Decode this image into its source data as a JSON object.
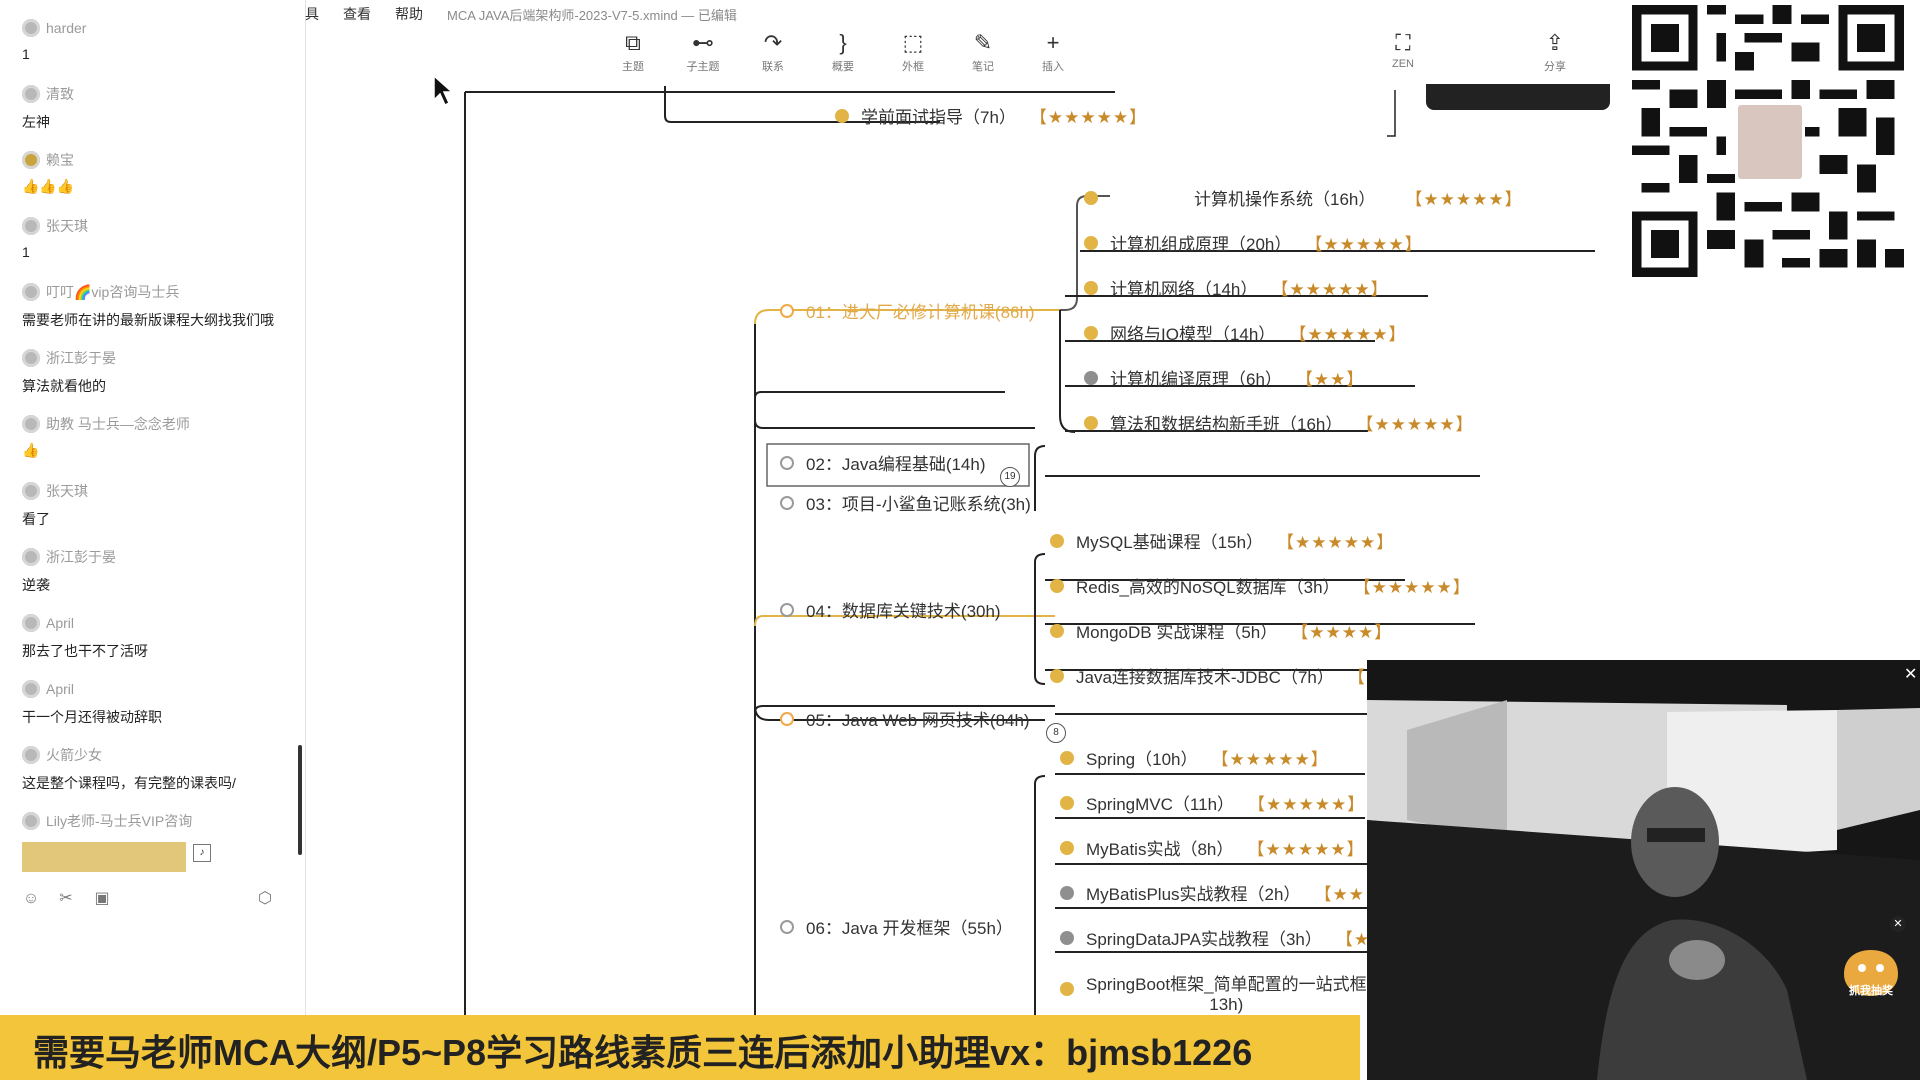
{
  "chat": {
    "messages": [
      {
        "user": "harder",
        "text": "1"
      },
      {
        "user": "清致",
        "text": "左神"
      },
      {
        "user": "赖宝",
        "text": "👍👍👍"
      },
      {
        "user": "张天琪",
        "text": "1"
      },
      {
        "user": "叮叮🌈vip咨询马士兵",
        "text": "需要老师在讲的最新版课程大纲找我们哦"
      },
      {
        "user": "浙江彭于晏",
        "text": "算法就看他的"
      },
      {
        "user": "助教 马士兵—念念老师",
        "text": "👍"
      },
      {
        "user": "张天琪",
        "text": "看了"
      },
      {
        "user": "浙江彭于晏",
        "text": "逆袭"
      },
      {
        "user": "April",
        "text": "那去了也干不了活呀"
      },
      {
        "user": "April",
        "text": "干一个月还得被动辞职"
      },
      {
        "user": "火箭少女",
        "text": "这是整个课程吗，有完整的课表吗/"
      },
      {
        "user": "Lily老师-马士兵VIP咨询",
        "text": ""
      }
    ],
    "tools": [
      "emoji-icon",
      "scissors-icon",
      "image-icon",
      "gift-icon"
    ]
  },
  "app": {
    "menu": [
      "具",
      "查看",
      "帮助"
    ],
    "document_title": "MCA JAVA后端架构师-2023-V7-5.xmind — 已编辑",
    "toolbar": [
      {
        "icon": "topic-icon",
        "label": "主题"
      },
      {
        "icon": "subtopic-icon",
        "label": "子主题"
      },
      {
        "icon": "relationship-icon",
        "label": "联系"
      },
      {
        "icon": "summary-icon",
        "label": "概要"
      },
      {
        "icon": "boundary-icon",
        "label": "外框"
      },
      {
        "icon": "note-icon",
        "label": "笔记"
      },
      {
        "icon": "insert-icon",
        "label": "插入"
      },
      {
        "icon": "zen-icon",
        "label": "ZEN"
      },
      {
        "icon": "share-icon",
        "label": "分享"
      }
    ]
  },
  "mindmap": {
    "top_node": {
      "label": "学前面试指导（7h）",
      "stars": "★★★★★"
    },
    "branches": [
      {
        "label": "01：进大厂必修计算机课(86h)",
        "children": [
          {
            "label": "计算机操作系统（16h）",
            "stars": "★★★★★"
          },
          {
            "label": "计算机组成原理（20h）",
            "stars": "★★★★★"
          },
          {
            "label": "计算机网络（14h）",
            "stars": "★★★★★"
          },
          {
            "label": "网络与IO模型（14h）",
            "stars": "★★★★★"
          },
          {
            "label": "计算机编译原理（6h）",
            "stars": "★★"
          },
          {
            "label": "算法和数据结构新手班（16h）",
            "stars": "★★★★★"
          }
        ]
      },
      {
        "label": "02：Java编程基础(14h)",
        "badge": "19"
      },
      {
        "label": "03：项目-小鲨鱼记账系统(3h)"
      },
      {
        "label": "04：数据库关键技术(30h)",
        "children": [
          {
            "label": "MySQL基础课程（15h）",
            "stars": "★★★★★"
          },
          {
            "label": "Redis_高效的NoSQL数据库（3h）",
            "stars": "★★★★★"
          },
          {
            "label": "MongoDB 实战课程（5h）",
            "stars": "★★★★"
          },
          {
            "label": "Java连接数据库技术-JDBC（7h）",
            "stars": "★"
          }
        ]
      },
      {
        "label": "05：Java Web 网页技术(84h)",
        "badge": "8"
      },
      {
        "label": "06：Java 开发框架（55h）",
        "children": [
          {
            "label": "Spring（10h）",
            "stars": "★★★★★"
          },
          {
            "label": "SpringMVC（11h）",
            "stars": "★★★★★"
          },
          {
            "label": "MyBatis实战（8h）",
            "stars": "★★★★★"
          },
          {
            "label": "MyBatisPlus实战教程（2h）",
            "stars": "★★"
          },
          {
            "label": "SpringDataJPA实战教程（3h）",
            "stars": "★"
          },
          {
            "label": "SpringBoot框架_简单配置的一站式框",
            "label2": "13h)"
          }
        ]
      }
    ]
  },
  "banner": {
    "text": "需要马老师MCA大纲/P5~P8学习路线素质三连后添加小助理vx：bjmsb1226"
  },
  "webcam": {
    "lottery_label": "抓我抽奖"
  }
}
